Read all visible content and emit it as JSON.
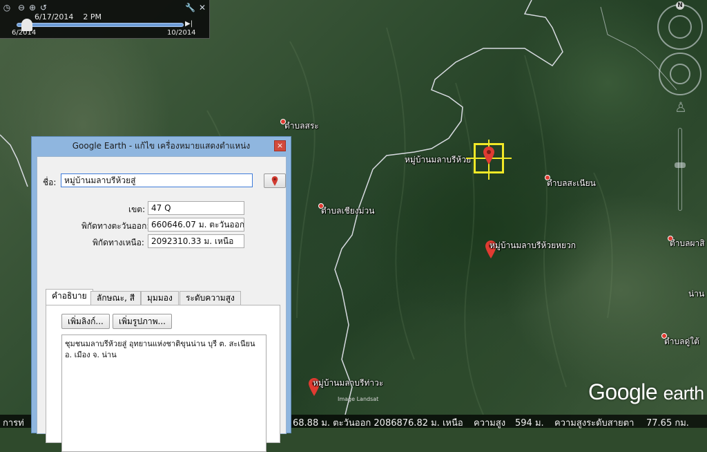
{
  "time_slider": {
    "current_date": "6/17/2014",
    "current_time": "2 PM",
    "start_label": "6/2014",
    "end_label": "10/2014",
    "position": 0.05,
    "icons": [
      "clock-icon",
      "zoom-out-icon",
      "zoom-in-icon",
      "history-icon",
      "wrench-icon",
      "close-icon"
    ]
  },
  "navigation": {
    "north_label": "N"
  },
  "map_labels": {
    "tambon_sa": "ตำบลสระ",
    "tambon_chiang_muan": "ตำบลเชียงม่วน",
    "target_pin": "หมู่บ้านมลาบรีห้วย",
    "tambon_sanian": "ตำบลสะเนียน",
    "village_huai_yuak": "หมู่บ้านมลาบรีห้วยหยวก",
    "tambon_pha": "ตำบลผาสิ",
    "nan": "น่าน",
    "tambon_du_tai": "ตำบลดู่ใต้",
    "village_bottom": "หมู่บ้านมลาบรีท่าวะ",
    "image_credit": "Image Landsat"
  },
  "logo": {
    "brand": "Google",
    "product": "earth"
  },
  "status_bar": {
    "left_text": "การท่",
    "coordinates": "68.88 ม. ตะวันออก 2086876.82 ม. เหนือ",
    "elev_label": "ความสูง",
    "elev_value": "594 ม.",
    "eye_label": "ความสูงระดับสายตา",
    "eye_value": "77.65 กม."
  },
  "dialog": {
    "title": "Google Earth - แก้ไข  เครื่องหมายแสดงตำแหน่ง",
    "close_label": "×",
    "name_label": "ชื่อ:",
    "name_value": "หมู่บ้านมลาบรีห้วยสู่",
    "zone_label": "เขต:",
    "zone_value": "47 Q",
    "easting_label": "พิกัดทางตะวันออก:",
    "easting_value": "660646.07 ม. ตะวันออก",
    "northing_label": "พิกัดทางเหนือ:",
    "northing_value": "2092310.33 ม. เหนือ",
    "tabs": [
      {
        "label": "คำอธิบาย",
        "active": true
      },
      {
        "label": "ลักษณะ, สี",
        "active": false
      },
      {
        "label": "มุมมอง",
        "active": false
      },
      {
        "label": "ระดับความสูง",
        "active": false
      }
    ],
    "add_link_label": "เพิ่มลิงก์...",
    "add_image_label": "เพิ่มรูปภาพ...",
    "description": "ชุมชนมลาบรีห้วยสู่ อุทยานแห่งชาติขุนน่าน บุรี ต. สะเนียน อ. เมือง จ. น่าน"
  },
  "colors": {
    "selector": "#f2e827",
    "pin": "#e03b32",
    "dialog_frame": "#8fb6df"
  }
}
